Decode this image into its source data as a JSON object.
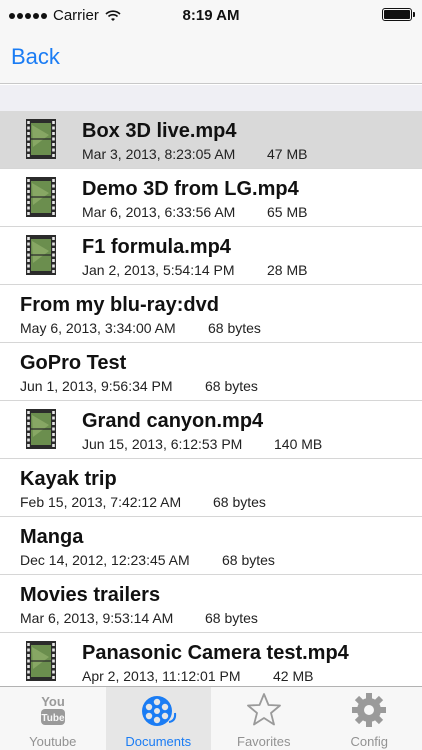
{
  "status": {
    "carrier": "Carrier",
    "time": "8:19 AM",
    "battery_level": 1.0
  },
  "nav": {
    "back_label": "Back"
  },
  "files": [
    {
      "kind": "file",
      "name": "Box 3D live.mp4",
      "date": "Mar 3, 2013, 8:23:05 AM",
      "size": "47 MB",
      "selected": true
    },
    {
      "kind": "file",
      "name": "Demo 3D from LG.mp4",
      "date": "Mar 6, 2013, 6:33:56 AM",
      "size": "65 MB"
    },
    {
      "kind": "file",
      "name": "F1 formula.mp4",
      "date": "Jan 2, 2013, 5:54:14 PM",
      "size": "28 MB"
    },
    {
      "kind": "folder",
      "name": "From my blu-ray:dvd",
      "date": "May 6, 2013, 3:34:00 AM",
      "size": "68 bytes"
    },
    {
      "kind": "folder",
      "name": "GoPro Test",
      "date": "Jun 1, 2013, 9:56:34 PM",
      "size": "68 bytes"
    },
    {
      "kind": "file",
      "name": "Grand canyon.mp4",
      "date": "Jun 15, 2013, 6:12:53 PM",
      "size": "140 MB"
    },
    {
      "kind": "folder",
      "name": "Kayak trip",
      "date": "Feb 15, 2013, 7:42:12 AM",
      "size": "68 bytes"
    },
    {
      "kind": "folder",
      "name": "Manga",
      "date": "Dec 14, 2012, 12:23:45 AM",
      "size": "68 bytes"
    },
    {
      "kind": "folder",
      "name": "Movies trailers",
      "date": "Mar 6, 2013, 9:53:14 AM",
      "size": "68 bytes"
    },
    {
      "kind": "file",
      "name": "Panasonic Camera test.mp4",
      "date": "Apr 2, 2013, 11:12:01 PM",
      "size": "42 MB"
    }
  ],
  "tabs": [
    {
      "label": "Youtube",
      "icon": "youtube-icon",
      "active": false
    },
    {
      "label": "Documents",
      "icon": "film-reel-icon",
      "active": true
    },
    {
      "label": "Favorites",
      "icon": "star-icon",
      "active": false
    },
    {
      "label": "Config",
      "icon": "gear-icon",
      "active": false
    }
  ],
  "colors": {
    "accent": "#1a7cf4",
    "selected_row": "#d9d9d9",
    "film": "#6b8e4e"
  }
}
